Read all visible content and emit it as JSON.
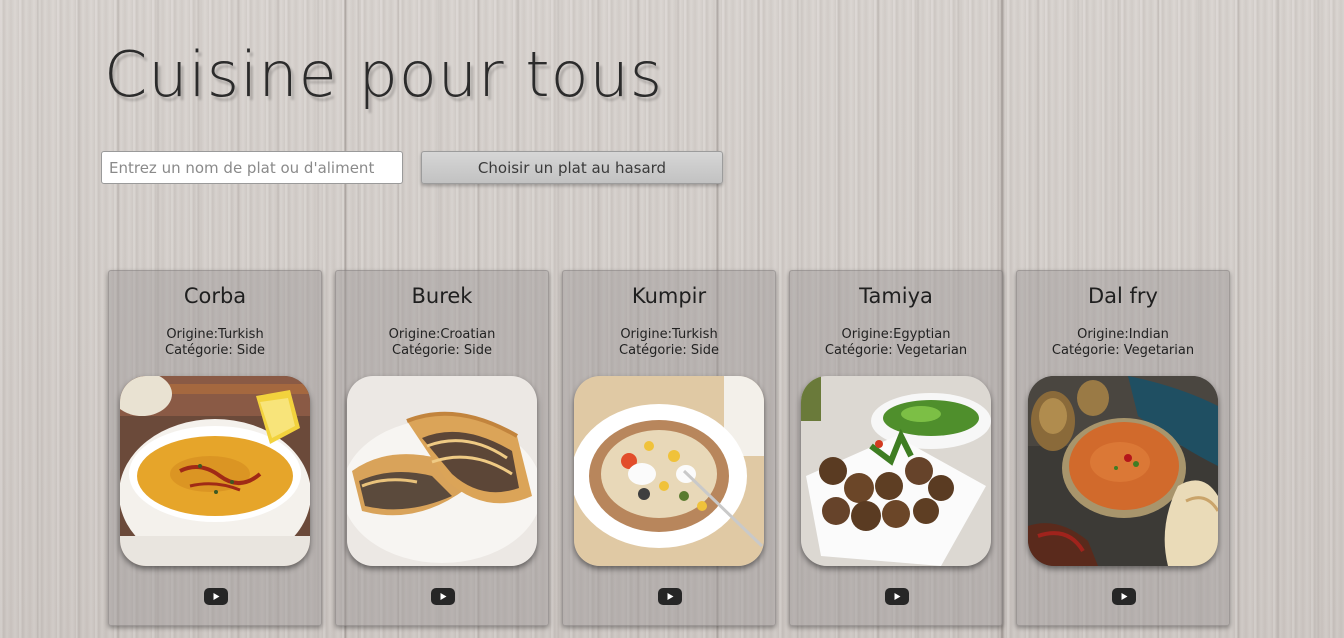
{
  "header": {
    "title": "Cuisine pour tous"
  },
  "search": {
    "placeholder": "Entrez un nom de plat ou d'aliment",
    "value": ""
  },
  "random_button": {
    "label": "Choisir un plat au hasard"
  },
  "colors": {
    "youtube_button": "#262626",
    "card_background": "#96918f"
  },
  "meals": [
    {
      "name": "Corba",
      "origin": "Origine:Turkish",
      "category": "Catégorie: Side",
      "video_icon": "youtube-icon"
    },
    {
      "name": "Burek",
      "origin": "Origine:Croatian",
      "category": "Catégorie: Side",
      "video_icon": "youtube-icon"
    },
    {
      "name": "Kumpir",
      "origin": "Origine:Turkish",
      "category": "Catégorie: Side",
      "video_icon": "youtube-icon"
    },
    {
      "name": "Tamiya",
      "origin": "Origine:Egyptian",
      "category": "Catégorie: Vegetarian",
      "video_icon": "youtube-icon"
    },
    {
      "name": "Dal fry",
      "origin": "Origine:Indian",
      "category": "Catégorie: Vegetarian",
      "video_icon": "youtube-icon"
    }
  ]
}
